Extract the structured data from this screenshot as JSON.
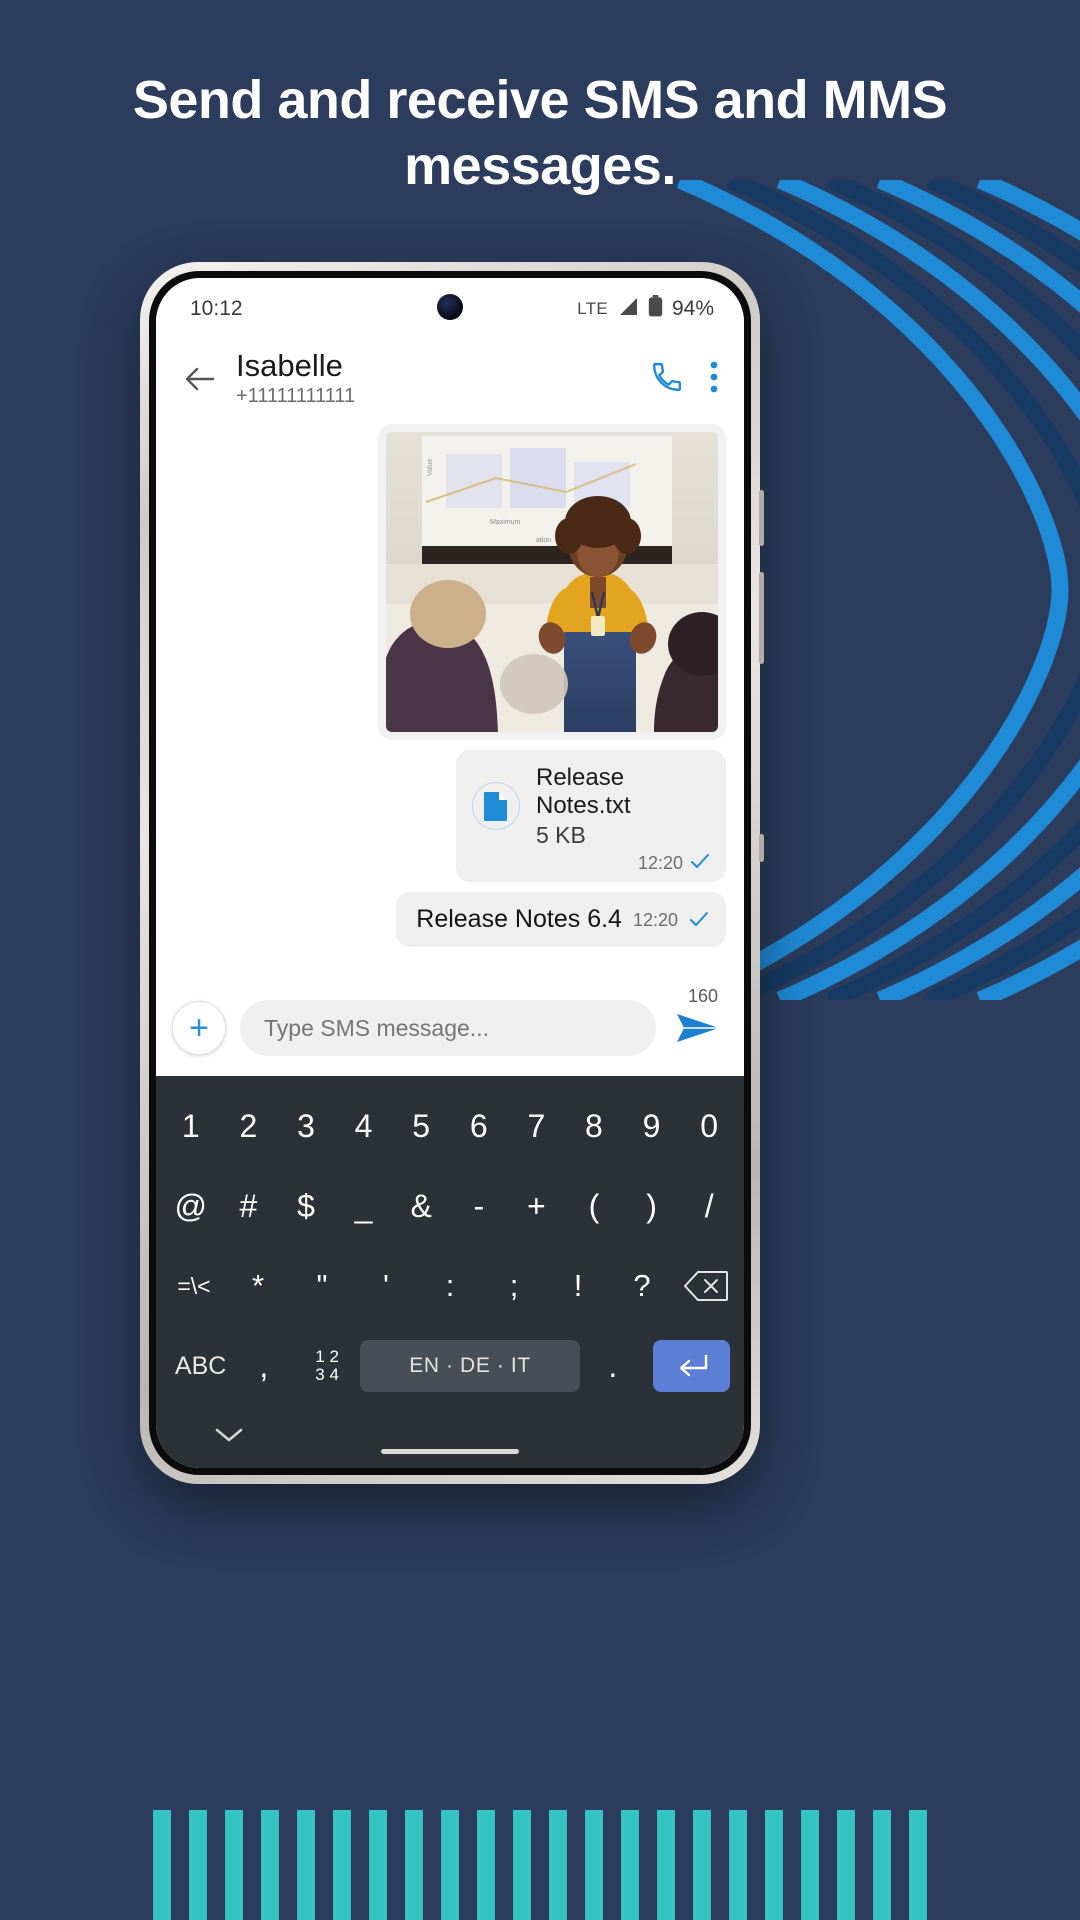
{
  "theme": {
    "background": "#2b3c5c",
    "accent_blue": "#1f8ad6",
    "stripe_teal": "#35c4c4",
    "keyboard_bg": "#2c3137",
    "enter_key_blue": "#5b7fd4"
  },
  "headline": "Send and receive SMS and MMS messages.",
  "phone": {
    "status_bar": {
      "time": "10:12",
      "network": "LTE",
      "battery_percent": "94%",
      "signal_icon": "signal-bars-icon",
      "battery_icon": "battery-icon",
      "camera_icon": "front-camera-punch-hole"
    },
    "conversation_header": {
      "back_icon": "back-arrow-icon",
      "contact_name": "Isabelle",
      "contact_number": "+11111111111",
      "call_icon": "phone-call-icon",
      "overflow_icon": "more-vertical-icon"
    },
    "messages": [
      {
        "type": "image",
        "name": "mms-image-bubble",
        "alt": "Woman in yellow sweater presenting to an audience"
      },
      {
        "type": "file",
        "name": "file-attachment-bubble",
        "icon": "document-file-icon",
        "file_name": "Release Notes.txt",
        "file_size": "5 KB",
        "time": "12:20",
        "status_icon": "delivered-check-icon"
      },
      {
        "type": "text",
        "name": "text-message-bubble",
        "text": "Release Notes 6.4",
        "time": "12:20",
        "status_icon": "delivered-check-icon"
      }
    ],
    "composer": {
      "attach_icon": "plus-icon",
      "placeholder": "Type SMS message...",
      "value": "",
      "char_counter": "160",
      "send_icon": "send-paper-plane-icon"
    },
    "keyboard": {
      "row1": [
        "1",
        "2",
        "3",
        "4",
        "5",
        "6",
        "7",
        "8",
        "9",
        "0"
      ],
      "row2": [
        "@",
        "#",
        "$",
        "_",
        "&",
        "-",
        "+",
        "(",
        ")",
        "/"
      ],
      "row3": [
        "=\\<",
        "*",
        "\"",
        "'",
        ":",
        ";",
        "!",
        "?"
      ],
      "backspace_icon": "backspace-icon",
      "row4": {
        "abc_key": "ABC",
        "comma_key": ",",
        "numeric_key": "1 2 3 4",
        "numeric_key_top": "1 2",
        "numeric_key_bottom": "3 4",
        "space_key": "EN · DE · IT",
        "period_key": ".",
        "enter_icon": "enter-return-icon"
      },
      "hide_keyboard_icon": "chevron-down-icon"
    }
  }
}
